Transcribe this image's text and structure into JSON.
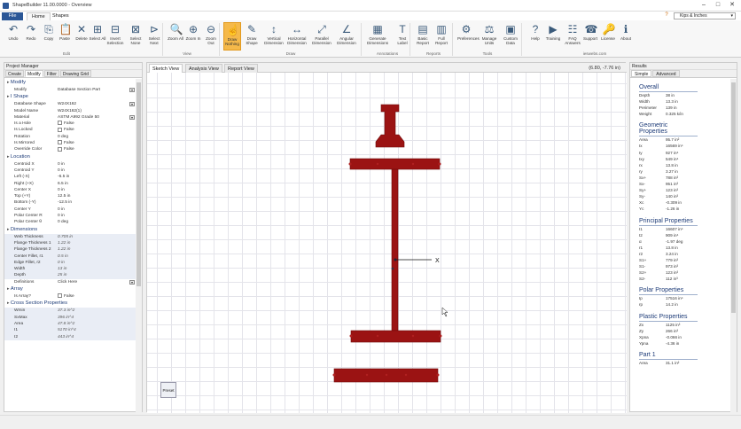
{
  "app": {
    "title": "ShapeBuilder 11.00.0000 - Overview"
  },
  "menu": {
    "file": "File",
    "tabs": [
      "Home",
      "Shapes"
    ],
    "units": "Kips & Inches"
  },
  "ribbon": {
    "buttons": [
      {
        "label": "Undo",
        "icon": "undo-icon"
      },
      {
        "label": "Redo",
        "icon": "redo-icon"
      },
      {
        "label": "Copy",
        "icon": "copy-icon"
      },
      {
        "label": "Paste",
        "icon": "paste-icon"
      },
      {
        "label": "Delete",
        "icon": "delete-icon"
      },
      {
        "label": "Select All",
        "icon": "select-all-icon"
      },
      {
        "label": "Invert Selection",
        "icon": "invert-selection-icon"
      },
      {
        "label": "Select None",
        "icon": "select-none-icon"
      },
      {
        "label": "Select Next",
        "icon": "select-next-icon"
      },
      {
        "label": "Zoom All",
        "icon": "zoom-all-icon"
      },
      {
        "label": "Zoom In",
        "icon": "zoom-in-icon"
      },
      {
        "label": "Zoom Out",
        "icon": "zoom-out-icon"
      },
      {
        "label": "Draw Nothing",
        "icon": "cursor-icon"
      },
      {
        "label": "Draw Shape",
        "icon": "draw-shape-icon"
      },
      {
        "label": "Vertical Dimension",
        "icon": "vertical-dimension-icon"
      },
      {
        "label": "Horizontal Dimension",
        "icon": "horizontal-dimension-icon"
      },
      {
        "label": "Parallel Dimension",
        "icon": "parallel-dimension-icon"
      },
      {
        "label": "Angular Dimension",
        "icon": "angular-dimension-icon"
      },
      {
        "label": "Generate Dimensions",
        "icon": "generate-dimensions-icon"
      },
      {
        "label": "Text Label",
        "icon": "text-label-icon"
      },
      {
        "label": "Basic Report",
        "icon": "basic-report-icon"
      },
      {
        "label": "Full Report",
        "icon": "full-report-icon"
      },
      {
        "label": "Preferences",
        "icon": "preferences-icon"
      },
      {
        "label": "Manage Units",
        "icon": "manage-units-icon"
      },
      {
        "label": "Custom Data",
        "icon": "custom-data-icon"
      },
      {
        "label": "Help",
        "icon": "help-icon"
      },
      {
        "label": "Training",
        "icon": "training-icon"
      },
      {
        "label": "FAQ Answers",
        "icon": "faq-icon"
      },
      {
        "label": "Support",
        "icon": "support-icon"
      },
      {
        "label": "License",
        "icon": "license-icon"
      },
      {
        "label": "About",
        "icon": "about-icon"
      }
    ],
    "groups": [
      "Edit",
      "View",
      "Draw",
      "Annotations",
      "Reports",
      "Tools",
      "ieswebs.com"
    ]
  },
  "project_manager": {
    "title": "Project Manager",
    "tabs": [
      "Create",
      "Modify",
      "Filter",
      "Drawing Grid"
    ],
    "sections": [
      {
        "title": "Modify",
        "rows": [
          {
            "k": "Modify",
            "v": "Database Section Part",
            "dd": true
          }
        ]
      },
      {
        "title": "I Shape",
        "rows": [
          {
            "k": "Database Shape",
            "v": "W24X162",
            "dd": true
          },
          {
            "k": "Model Name",
            "v": "W24X162(1)"
          },
          {
            "k": "Material",
            "v": "ASTM A992 Grade 50",
            "dd": true
          },
          {
            "k": "Is a Hole",
            "v": "False",
            "cb": true
          },
          {
            "k": "Is Locked",
            "v": "False",
            "cb": true
          },
          {
            "k": "Rotation",
            "v": "0 deg"
          },
          {
            "k": "Is Mirrored",
            "v": "False",
            "cb": true
          },
          {
            "k": "Override Color",
            "v": "False",
            "cb": true
          }
        ]
      },
      {
        "title": "Location",
        "rows": [
          {
            "k": "Centroid X",
            "v": "0 in"
          },
          {
            "k": "Centroid Y",
            "v": "0 in"
          },
          {
            "k": "Left (-X)",
            "v": "-6.5 in"
          },
          {
            "k": "Right (+X)",
            "v": "6.5 in"
          },
          {
            "k": "Center X",
            "v": "0 in"
          },
          {
            "k": "Top (+Y)",
            "v": "12.5 in"
          },
          {
            "k": "Bottom (-Y)",
            "v": "-12.5 in"
          },
          {
            "k": "Center Y",
            "v": "0 in"
          },
          {
            "k": "Polar Center R",
            "v": "0 in"
          },
          {
            "k": "Polar Center θ",
            "v": "0 deg"
          }
        ]
      },
      {
        "title": "Dimensions",
        "rows": [
          {
            "k": "Web Thickness",
            "v": "0.705 in",
            "shade": true
          },
          {
            "k": "Flange Thickness 1",
            "v": "1.22 in",
            "shade": true
          },
          {
            "k": "Flange Thickness 2",
            "v": "1.22 in",
            "shade": true
          },
          {
            "k": "Center Fillet, r1",
            "v": "0.5 in",
            "shade": true
          },
          {
            "k": "Edge Fillet, r2",
            "v": "0 in",
            "shade": true
          },
          {
            "k": "Width",
            "v": "13 in",
            "shade": true
          },
          {
            "k": "Depth",
            "v": "25 in",
            "shade": true
          },
          {
            "k": "Definitions",
            "v": "Click Here",
            "dd": true
          }
        ]
      },
      {
        "title": "Array",
        "rows": [
          {
            "k": "Is Array?",
            "v": "False",
            "cb": true
          }
        ]
      },
      {
        "title": "Cross Section Properties",
        "rows": [
          {
            "k": "Wmin",
            "v": "37.3 in^2",
            "shade": true
          },
          {
            "k": "SxMax",
            "v": "396 in^4",
            "shade": true
          },
          {
            "k": "Area",
            "v": "47.8 in^2",
            "shade": true
          },
          {
            "k": "I1",
            "v": "5170 in^4",
            "shade": true
          },
          {
            "k": "I2",
            "v": "443 in^4",
            "shade": true
          }
        ]
      }
    ]
  },
  "canvas": {
    "tabs": [
      "Sketch View",
      "Analysis View",
      "Report View"
    ],
    "coords": "(6.80, -7.76 in)",
    "axis_label": "X",
    "dock_label": "Preset"
  },
  "results": {
    "title": "Results",
    "tabs": [
      "Simple",
      "Advanced"
    ],
    "sections": [
      {
        "title": "Overall",
        "rows": [
          {
            "k": "Depth",
            "v": "38 in"
          },
          {
            "k": "Width",
            "v": "13.3 in"
          },
          {
            "k": "Perimeter",
            "v": "139 in"
          },
          {
            "k": "Weight",
            "v": "0.325 k/in"
          }
        ]
      },
      {
        "title": "Geometric Properties",
        "rows": [
          {
            "k": "Area",
            "v": "95.7 in²"
          },
          {
            "k": "Ix",
            "v": "16569 in⁴"
          },
          {
            "k": "Iy",
            "v": "927 in⁴"
          },
          {
            "k": "Ixy",
            "v": "549 in⁴"
          },
          {
            "k": "rx",
            "v": "13.8 in"
          },
          {
            "k": "ry",
            "v": "3.27 in"
          },
          {
            "k": "Sx+",
            "v": "788 in³"
          },
          {
            "k": "Sx-",
            "v": "951 in³"
          },
          {
            "k": "Sy+",
            "v": "123 in³"
          },
          {
            "k": "Sy-",
            "v": "140 in³"
          },
          {
            "k": "Xc",
            "v": "-0.309 in"
          },
          {
            "k": "Yc",
            "v": "-1.26 in"
          }
        ]
      },
      {
        "title": "Principal Properties",
        "rows": [
          {
            "k": "I1",
            "v": "16607 in⁴"
          },
          {
            "k": "I2",
            "v": "909 in⁴"
          },
          {
            "k": "α",
            "v": "-1.97 deg"
          },
          {
            "k": "r1",
            "v": "13.8 in"
          },
          {
            "k": "r2",
            "v": "3.24 in"
          },
          {
            "k": "S1+",
            "v": "779 in³"
          },
          {
            "k": "S1-",
            "v": "973 in³"
          },
          {
            "k": "S2+",
            "v": "123 in³"
          },
          {
            "k": "S2-",
            "v": "112 in³"
          }
        ]
      },
      {
        "title": "Polar Properties",
        "rows": [
          {
            "k": "Ip",
            "v": "17516 in⁴"
          },
          {
            "k": "rp",
            "v": "14.2 in"
          }
        ]
      },
      {
        "title": "Plastic Properties",
        "rows": [
          {
            "k": "Zx",
            "v": "1125 in³"
          },
          {
            "k": "Zy",
            "v": "266 in³"
          },
          {
            "k": "Xpna",
            "v": "-0.066 in"
          },
          {
            "k": "Ypna",
            "v": "-4.36 in"
          }
        ]
      },
      {
        "title": "Part 1",
        "rows": [
          {
            "k": "Area",
            "v": "31.1 in²"
          }
        ]
      }
    ]
  },
  "colors": {
    "shape_fill": "#9b1313",
    "shape_edge": "#6e0c0c",
    "selected_button": "#f5b94a",
    "header_blue": "#1e3c78"
  }
}
